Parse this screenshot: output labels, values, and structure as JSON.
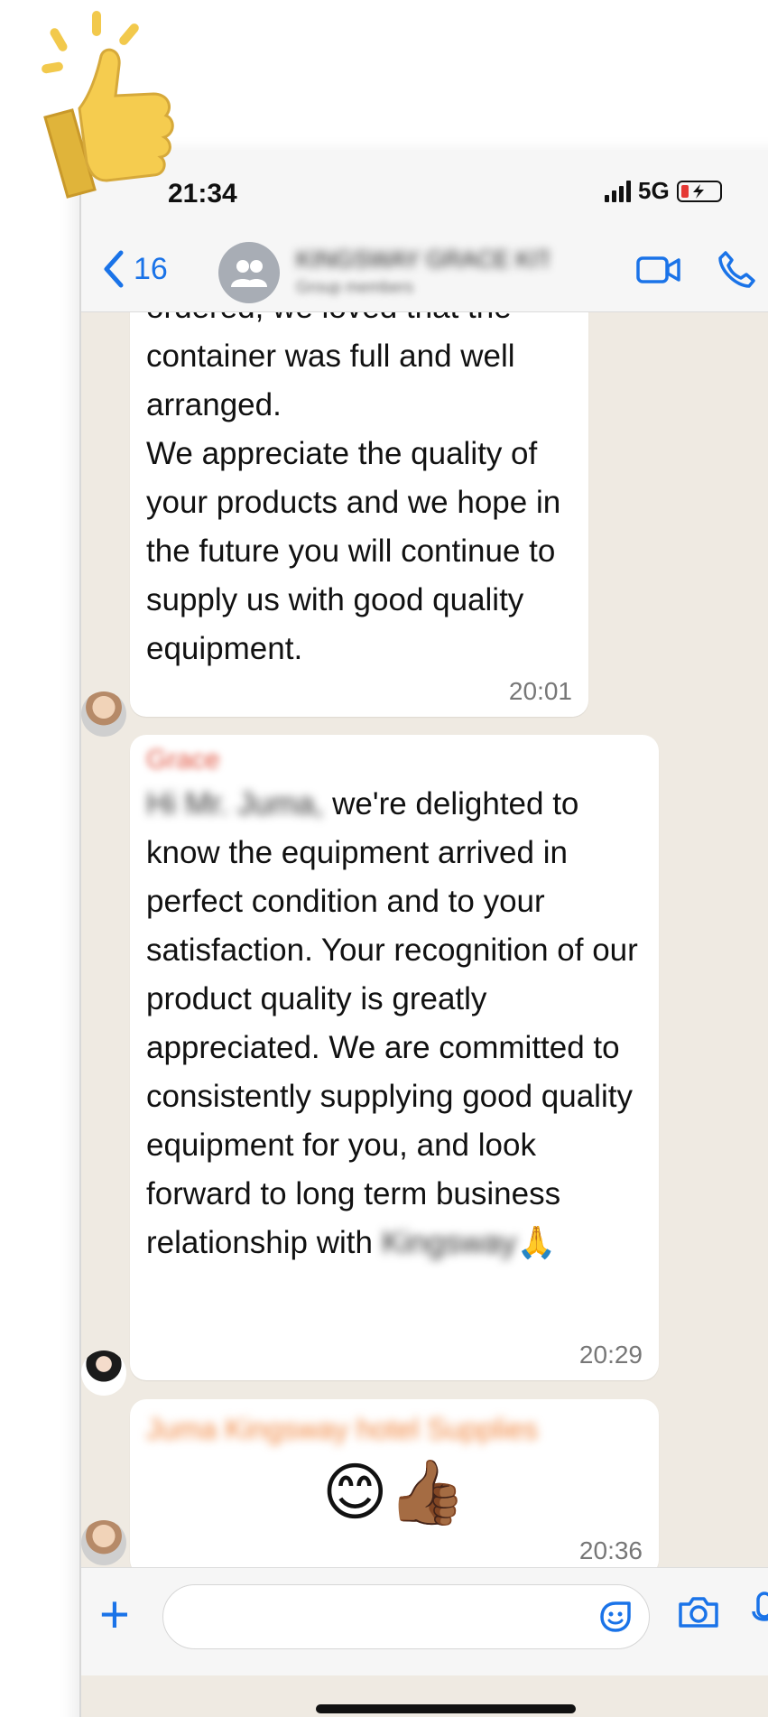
{
  "status_bar": {
    "time": "21:34",
    "network": "5G"
  },
  "nav": {
    "back_count": "16",
    "chat_title": "KINGSWAY GRACE KIT...",
    "chat_subtitle": "Group members"
  },
  "messages": [
    {
      "text": "ordered, we loved that the container was full and well arranged.\nWe appreciate the quality of your products and we hope in the future you will continue to supply us with good quality equipment.",
      "time": "20:01"
    },
    {
      "sender": "Grace",
      "greeting": "Hi Mr. Juma,",
      "text_a": " we're delighted to know the equipment arrived in perfect condition and to your satisfaction. Your recognition of our product quality is greatly appreciated. We are committed to consistently supplying good quality equipment for you, and look forward to long term business relationship with ",
      "company": "Kingsway",
      "emoji": "🙏",
      "time": "20:29"
    },
    {
      "sender": "Juma Kingsway hotel Supplies",
      "emojis": "😊👍🏾",
      "time": "20:36"
    }
  ],
  "input": {
    "placeholder": ""
  },
  "colors": {
    "accent": "#1a73e8",
    "chat_bg": "#efeae2",
    "bubble": "#ffffff"
  },
  "icons": [
    "thumbs-up-sticker-icon",
    "back-chevron-icon",
    "group-avatar-icon",
    "video-call-icon",
    "phone-call-icon",
    "plus-icon",
    "sticker-icon",
    "camera-icon",
    "mic-icon"
  ]
}
